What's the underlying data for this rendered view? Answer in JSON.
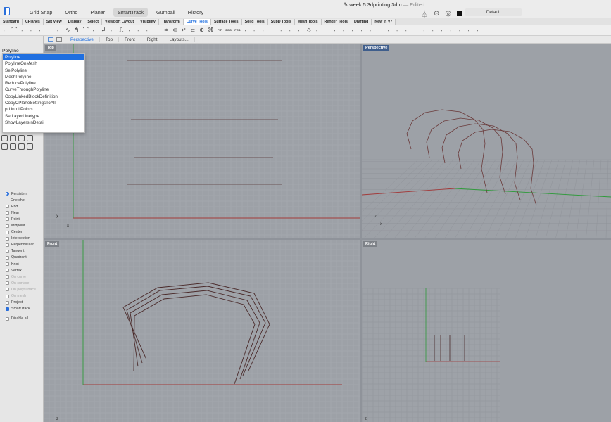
{
  "window": {
    "title": "week 5 3dprinting.3dm",
    "title_separator": "—",
    "status": "Edited",
    "layer": "Default"
  },
  "modes": [
    "Grid Snap",
    "Ortho",
    "Planar",
    "SmartTrack",
    "Gumball",
    "History"
  ],
  "active_mode": "SmartTrack",
  "toolbar_tabs": [
    "Standard",
    "CPlanes",
    "Set View",
    "Display",
    "Select",
    "Viewport Layout",
    "Visibility",
    "Transform",
    "Curve Tools",
    "Surface Tools",
    "Solid Tools",
    "SubD Tools",
    "Mesh Tools",
    "Render Tools",
    "Drafting",
    "New in V7"
  ],
  "active_tab": "Curve Tools",
  "icon_labels": [
    "FIT",
    "DEG",
    "FRB"
  ],
  "viewport_tabs": [
    "Perspective",
    "Top",
    "Front",
    "Right",
    "Layouts..."
  ],
  "active_viewport_tab": "Perspective",
  "command": {
    "input": "Polyline",
    "suggestions": [
      "Polyline",
      "PolylineOnMesh",
      "SelPolyline",
      "MeshPolyline",
      "ReducePolyline",
      "CurveThroughPolyline",
      "CopyLinkedBlockDefinition",
      "CopyCPlaneSettingsToAll",
      "prUnrollPoints",
      "SetLayerLinetype",
      "ShowLayersInDetail"
    ],
    "selected_index": 0
  },
  "osnap": {
    "persistent_label": "Persistent",
    "one_shot_label": "One shot",
    "items": [
      {
        "label": "End",
        "checked": false,
        "enabled": true
      },
      {
        "label": "Near",
        "checked": false,
        "enabled": true
      },
      {
        "label": "Point",
        "checked": false,
        "enabled": true
      },
      {
        "label": "Midpoint",
        "checked": false,
        "enabled": true
      },
      {
        "label": "Center",
        "checked": false,
        "enabled": true
      },
      {
        "label": "Intersection",
        "checked": false,
        "enabled": true
      },
      {
        "label": "Perpendicular",
        "checked": false,
        "enabled": true
      },
      {
        "label": "Tangent",
        "checked": false,
        "enabled": true
      },
      {
        "label": "Quadrant",
        "checked": false,
        "enabled": true
      },
      {
        "label": "Knot",
        "checked": false,
        "enabled": true
      },
      {
        "label": "Vertex",
        "checked": false,
        "enabled": true
      },
      {
        "label": "On curve",
        "checked": false,
        "enabled": false
      },
      {
        "label": "On surface",
        "checked": false,
        "enabled": false
      },
      {
        "label": "On polysurface",
        "checked": false,
        "enabled": false
      },
      {
        "label": "On mesh",
        "checked": false,
        "enabled": false
      },
      {
        "label": "Project",
        "checked": false,
        "enabled": true
      },
      {
        "label": "SmartTrack",
        "checked": true,
        "enabled": true
      }
    ],
    "disable_all": "Disable all"
  },
  "viewports": {
    "top": {
      "label": "Top",
      "axis_y": "y",
      "axis_x": "x"
    },
    "perspective": {
      "label": "Perspective",
      "axis_z": "z",
      "axis_x": "x"
    },
    "front": {
      "label": "Front",
      "axis_z": "z"
    },
    "right": {
      "label": "Right",
      "axis_z": "z"
    }
  },
  "colors": {
    "accent": "#1f6fe0",
    "x_axis": "#a23a3a",
    "y_axis": "#2e9a3a",
    "curve": "#5a3a3a",
    "viewport_bg": "#9da1a7",
    "grid": "#a7abb1"
  }
}
